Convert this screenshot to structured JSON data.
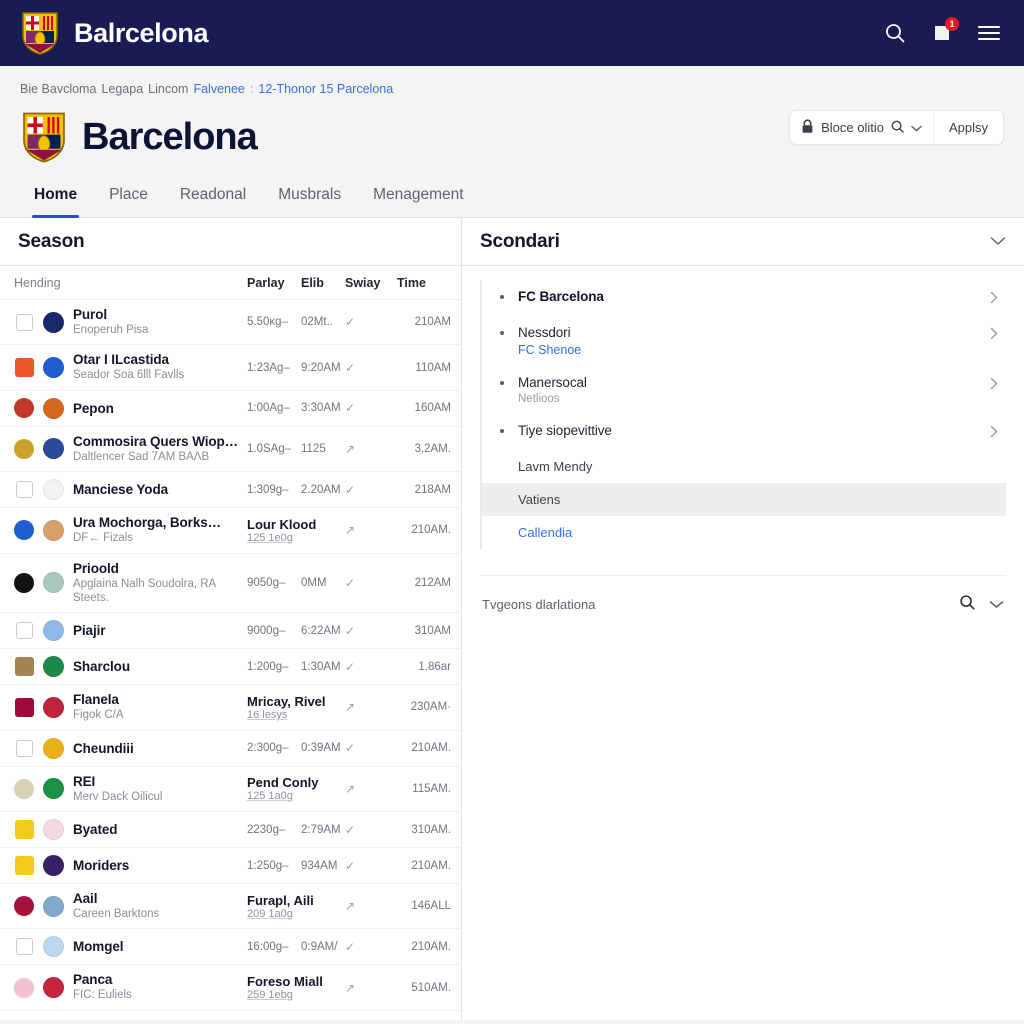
{
  "navbar": {
    "brand": "Balrcelona",
    "search_icon": "search-icon",
    "notification_icon": "notification-icon",
    "notification_count": "1",
    "menu_icon": "hamburger-menu-icon"
  },
  "breadcrumb": {
    "parts": [
      "Bie Bavcloma",
      "Legapa",
      "Lincom"
    ],
    "link": "Falvenee",
    "sep": ":",
    "tail": "12-Thonor 15 Parcelona"
  },
  "header": {
    "title": "Barcelona",
    "filter_label": "Bloce olitio",
    "filter_lock_icon": "lock-icon",
    "filter_search_icon": "search-icon",
    "filter_chevron_icon": "chevron-down-icon",
    "apply_label": "Applsy"
  },
  "tabs": [
    {
      "label": "Home",
      "active": true
    },
    {
      "label": "Place",
      "active": false
    },
    {
      "label": "Readonal",
      "active": false
    },
    {
      "label": "Musbrals",
      "active": false
    },
    {
      "label": "Menagement",
      "active": false
    }
  ],
  "left_pane": {
    "title": "Season",
    "columns": {
      "name": "Hending",
      "parlay": "Parlay",
      "elib": "Elib",
      "sway": "Swiay",
      "time": "Time"
    },
    "rows": [
      {
        "mark": "checkbox",
        "mark_color": "",
        "avatar_color": "#1c2a6b",
        "title": "Purol",
        "subtitle": "Enoperuh Pisa",
        "parlay": "5.50ĸg–",
        "elib": "02Mt..",
        "sway": "✓",
        "time": "210AM",
        "mid_strong": null
      },
      {
        "mark": "square",
        "mark_color": "#e8562a",
        "avatar_color": "#1d5fd0",
        "title": "Otar I ILcastida",
        "subtitle": "Seador Soa 6lll Favlls",
        "parlay": "1:23Ag–",
        "elib": "9:20AM",
        "sway": "✓",
        "time": "110AM",
        "mid_strong": null
      },
      {
        "mark": "dot",
        "mark_color": "#c0392b",
        "avatar_color": "#d2691e",
        "title": "Pepon",
        "subtitle": "",
        "parlay": "1:00Ag–",
        "elib": "3:30AM",
        "sway": "✓",
        "time": "160AM",
        "mid_strong": null
      },
      {
        "mark": "dot",
        "mark_color": "#c9a227",
        "avatar_color": "#2c4a9b",
        "title": "Commosira Quers Wiop…",
        "subtitle": "Daltlencer Sad 7AM BAΛB",
        "parlay": "1.0SAg–",
        "elib": "1125",
        "sway": "↗",
        "time": "3,2AM.",
        "mid_strong": null
      },
      {
        "mark": "checkbox",
        "mark_color": "",
        "avatar_color": "#f2f2f2",
        "title": "Manciese Yoda",
        "subtitle": "",
        "parlay": "1:309g–",
        "elib": "2.20AM",
        "sway": "✓",
        "time": "218AM",
        "mid_strong": null
      },
      {
        "mark": "dot",
        "mark_color": "#1d5fd0",
        "avatar_color": "#d8a06a",
        "title": "Ura Mochorga, Borks…",
        "subtitle": "DF← Fizals",
        "parlay": "",
        "elib": "",
        "sway": "↗",
        "time": "210AM.",
        "mid_strong": {
          "title": "Lour Klood",
          "sub": "125 1e0g"
        }
      },
      {
        "mark": "dot",
        "mark_color": "#111111",
        "avatar_color": "#a9c6bf",
        "title": "Prioold",
        "subtitle": "Apglaina Nalh Soudolra, RA Steets.",
        "parlay": "9050g–",
        "elib": "0MM",
        "sway": "✓",
        "time": "212AM",
        "mid_strong": null
      },
      {
        "mark": "checkbox",
        "mark_color": "",
        "avatar_color": "#8fb8e8",
        "title": "Piajir",
        "subtitle": "",
        "parlay": "9000g–",
        "elib": "6:22AM",
        "sway": "✓",
        "time": "310AM",
        "mid_strong": null
      },
      {
        "mark": "square",
        "mark_color": "#a58352",
        "avatar_color": "#1d8a4a",
        "title": "Sharclou",
        "subtitle": "",
        "parlay": "1:200g–",
        "elib": "1:30AM",
        "sway": "✓",
        "time": "1.86ar",
        "mid_strong": null
      },
      {
        "mark": "square",
        "mark_color": "#9e0b3a",
        "avatar_color": "#c0243c",
        "title": "Flanela",
        "subtitle": "Figok C/A",
        "parlay": "",
        "elib": "",
        "sway": "↗",
        "time": "230AM·",
        "mid_strong": {
          "title": "Mricay, Rivel",
          "sub": "16 lesys"
        }
      },
      {
        "mark": "checkbox",
        "mark_color": "",
        "avatar_color": "#e8b11c",
        "title": "Cheundiii",
        "subtitle": "",
        "parlay": "2:300g–",
        "elib": "0:39AM",
        "sway": "✓",
        "time": "210AM.",
        "mid_strong": null
      },
      {
        "mark": "dot",
        "mark_color": "#d8d2b5",
        "avatar_color": "#1a9146",
        "title": "REI",
        "subtitle": "Merv Dack Oilicul",
        "parlay": "",
        "elib": "",
        "sway": "↗",
        "time": "115AM.",
        "mid_strong": {
          "title": "Pend Conly",
          "sub": "125 1a0g"
        }
      },
      {
        "mark": "square",
        "mark_color": "#f2cb1d",
        "avatar_color": "#f4d8e2",
        "title": "Byated",
        "subtitle": "",
        "parlay": "2230g–",
        "elib": "2:79AM",
        "sway": "✓",
        "time": "310AM.",
        "mid_strong": null
      },
      {
        "mark": "square",
        "mark_color": "#f2cb1d",
        "avatar_color": "#3b1f63",
        "title": "Moriders",
        "subtitle": "",
        "parlay": "1:250g–",
        "elib": "934AM",
        "sway": "✓",
        "time": "210AM.",
        "mid_strong": null
      },
      {
        "mark": "dot",
        "mark_color": "#a4123c",
        "avatar_color": "#7fa8cc",
        "title": "Aail",
        "subtitle": "Careen Barktons",
        "parlay": "",
        "elib": "",
        "sway": "↗",
        "time": "146ALL",
        "mid_strong": {
          "title": "Furapl, Aili",
          "sub": "209 1a0g"
        }
      },
      {
        "mark": "checkbox",
        "mark_color": "",
        "avatar_color": "#bcd8ef",
        "title": "Momgel",
        "subtitle": "",
        "parlay": "16:00g–",
        "elib": "0:9AM/",
        "sway": "✓",
        "time": "210AM.",
        "mid_strong": null
      },
      {
        "mark": "dot",
        "mark_color": "#f0c0cf",
        "avatar_color": "#c4243c",
        "title": "Panca",
        "subtitle": "FIC: Euliels",
        "parlay": "",
        "elib": "",
        "sway": "↗",
        "time": "510AM.",
        "mid_strong": {
          "title": "Foreso Miall",
          "sub": "259 1ebg"
        }
      }
    ]
  },
  "right_pane": {
    "title": "Scondari",
    "collapse_icon": "chevron-down-icon",
    "items": [
      {
        "type": "bullet",
        "title": "FC Barcelona",
        "bold": true,
        "sub": "",
        "sub_muted": false,
        "chevron": true
      },
      {
        "type": "bullet",
        "title": "Nessdori",
        "bold": false,
        "sub": "FC Shenoe",
        "sub_muted": false,
        "chevron": true
      },
      {
        "type": "bullet",
        "title": "Manersocal",
        "bold": false,
        "sub": "Netlioos",
        "sub_muted": true,
        "chevron": true
      },
      {
        "type": "bullet",
        "title": "Tiye siopevittive",
        "bold": false,
        "sub": "",
        "sub_muted": false,
        "chevron": true
      },
      {
        "type": "plain",
        "title": "Lavm Mendy",
        "selected": false,
        "link": false
      },
      {
        "type": "plain",
        "title": "Vatiens",
        "selected": true,
        "link": false
      },
      {
        "type": "plain",
        "title": "Callendia",
        "selected": false,
        "link": true
      }
    ],
    "footer": {
      "text": "Tvgeons dlarlationa",
      "search_icon": "search-icon",
      "chevron_icon": "chevron-down-icon"
    }
  },
  "colors": {
    "navy": "#181c52",
    "accent": "#2552b8",
    "link": "#3a6fd8",
    "badge": "#e01b28"
  }
}
